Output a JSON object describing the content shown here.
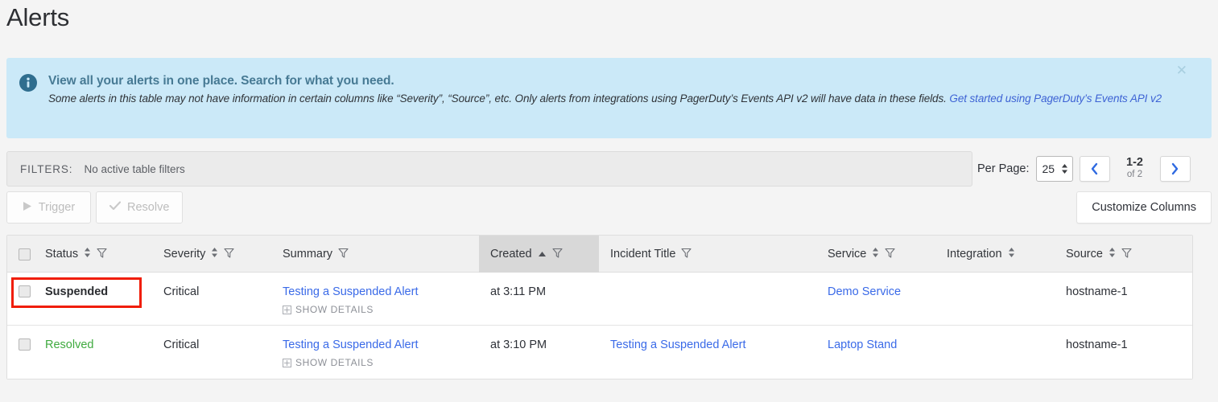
{
  "page_title": "Alerts",
  "banner": {
    "icon": "info-circle-icon",
    "title": "View all your alerts in one place. Search for what you need.",
    "text_before_link": "Some alerts in this table may not have information in certain columns like “Severity”, “Source”, etc. Only alerts from integrations using PagerDuty’s Events API v2 will have data in these fields. ",
    "link_text": "Get started using PagerDuty’s Events API v2",
    "close_label": "✕",
    "bg_color": "#cbe9f8",
    "title_color": "#477a94",
    "link_color": "#3d62d4"
  },
  "filters": {
    "label": "FILTERS:",
    "value": "No active table filters"
  },
  "pagination": {
    "per_page_label": "Per Page:",
    "per_page_value": "25",
    "prev_label": "‹",
    "next_label": "›",
    "range": "1-2",
    "total": "of 2"
  },
  "actions": {
    "trigger_label": "Trigger",
    "trigger_icon": "play-icon",
    "resolve_label": "Resolve",
    "resolve_icon": "check-icon",
    "customize_columns_label": "Customize Columns"
  },
  "table": {
    "select_all": "select-all-checkbox",
    "columns": [
      {
        "label": "Status",
        "sortable": true,
        "filterable": true,
        "sorted": false
      },
      {
        "label": "Severity",
        "sortable": true,
        "filterable": true,
        "sorted": false
      },
      {
        "label": "Summary",
        "sortable": false,
        "filterable": true,
        "sorted": false
      },
      {
        "label": "Created",
        "sortable": false,
        "filterable": true,
        "sorted": true,
        "sort_dir": "asc"
      },
      {
        "label": "Incident Title",
        "sortable": false,
        "filterable": true,
        "sorted": false
      },
      {
        "label": "Service",
        "sortable": true,
        "filterable": true,
        "sorted": false
      },
      {
        "label": "Integration",
        "sortable": true,
        "filterable": false,
        "sorted": false
      },
      {
        "label": "Source",
        "sortable": true,
        "filterable": true,
        "sorted": false
      }
    ],
    "show_details_label": "SHOW DETAILS",
    "rows": [
      {
        "status": "Suspended",
        "status_style": "suspended",
        "severity": "Critical",
        "summary": "Testing a Suspended Alert",
        "created": "at 3:11 PM",
        "incident_title": "",
        "service": "Demo Service",
        "integration": "",
        "source": "hostname-1",
        "highlighted": true
      },
      {
        "status": "Resolved",
        "status_style": "resolved",
        "severity": "Critical",
        "summary": "Testing a Suspended Alert",
        "created": "at 3:10 PM",
        "incident_title": "Testing a Suspended Alert",
        "service": "Laptop Stand",
        "integration": "",
        "source": "hostname-1",
        "highlighted": false
      }
    ]
  },
  "colors": {
    "link": "#3a6ae8",
    "resolved_green": "#3faa3f",
    "highlight_red": "#f01d06"
  }
}
